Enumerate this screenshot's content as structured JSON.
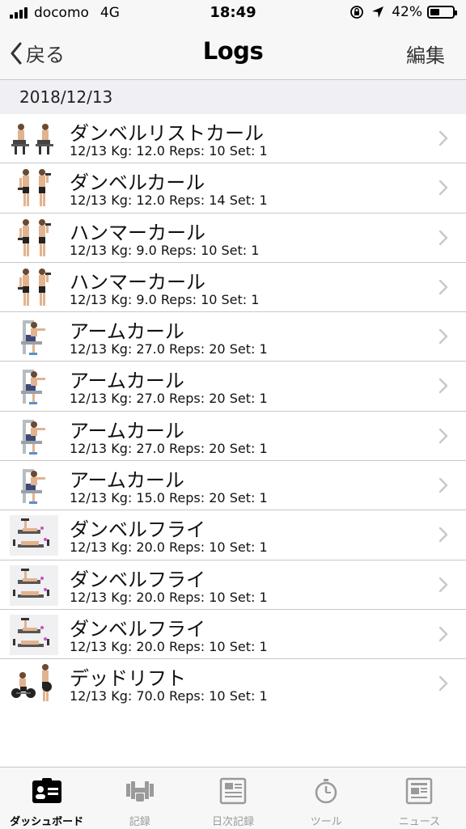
{
  "status": {
    "carrier": "docomo",
    "network": "4G",
    "time": "18:49",
    "battery": "42%"
  },
  "nav": {
    "back_label": "戻る",
    "title": "Logs",
    "edit_label": "編集"
  },
  "section": {
    "date": "2018/12/13"
  },
  "logs": [
    {
      "name": "ダンベルリストカール",
      "detail": "12/13  Kg: 12.0  Reps: 10  Set: 1",
      "icon": "wrist-curl-thumbnail"
    },
    {
      "name": "ダンベルカール",
      "detail": "12/13  Kg: 12.0  Reps: 14  Set: 1",
      "icon": "dumbbell-curl-thumbnail"
    },
    {
      "name": "ハンマーカール",
      "detail": "12/13  Kg: 9.0  Reps: 10  Set: 1",
      "icon": "hammer-curl-thumbnail"
    },
    {
      "name": "ハンマーカール",
      "detail": "12/13  Kg: 9.0  Reps: 10  Set: 1",
      "icon": "hammer-curl-thumbnail"
    },
    {
      "name": "アームカール",
      "detail": "12/13  Kg: 27.0  Reps: 20  Set: 1",
      "icon": "arm-curl-machine-thumbnail"
    },
    {
      "name": "アームカール",
      "detail": "12/13  Kg: 27.0  Reps: 20  Set: 1",
      "icon": "arm-curl-machine-thumbnail"
    },
    {
      "name": "アームカール",
      "detail": "12/13  Kg: 27.0  Reps: 20  Set: 1",
      "icon": "arm-curl-machine-thumbnail"
    },
    {
      "name": "アームカール",
      "detail": "12/13  Kg: 15.0  Reps: 20  Set: 1",
      "icon": "arm-curl-machine-thumbnail"
    },
    {
      "name": "ダンベルフライ",
      "detail": "12/13  Kg: 20.0  Reps: 10  Set: 1",
      "icon": "dumbbell-fly-thumbnail"
    },
    {
      "name": "ダンベルフライ",
      "detail": "12/13  Kg: 20.0  Reps: 10  Set: 1",
      "icon": "dumbbell-fly-thumbnail"
    },
    {
      "name": "ダンベルフライ",
      "detail": "12/13  Kg: 20.0  Reps: 10  Set: 1",
      "icon": "dumbbell-fly-thumbnail"
    },
    {
      "name": "デッドリフト",
      "detail": "12/13  Kg: 70.0  Reps: 10  Set: 1",
      "icon": "deadlift-thumbnail"
    }
  ],
  "tabs": [
    {
      "label": "ダッシュボード",
      "icon": "dashboard-icon",
      "active": true
    },
    {
      "label": "記録",
      "icon": "dumbbell-icon",
      "active": false
    },
    {
      "label": "日次記録",
      "icon": "daily-log-icon",
      "active": false
    },
    {
      "label": "ツール",
      "icon": "stopwatch-icon",
      "active": false
    },
    {
      "label": "ニュース",
      "icon": "news-icon",
      "active": false
    }
  ],
  "colors": {
    "bar_bg": "#f7f7f7",
    "section_bg": "#efeff4",
    "separator": "#c8c8cc",
    "inactive_tab": "#9a9a9a",
    "chevron": "#c7c7cc"
  }
}
